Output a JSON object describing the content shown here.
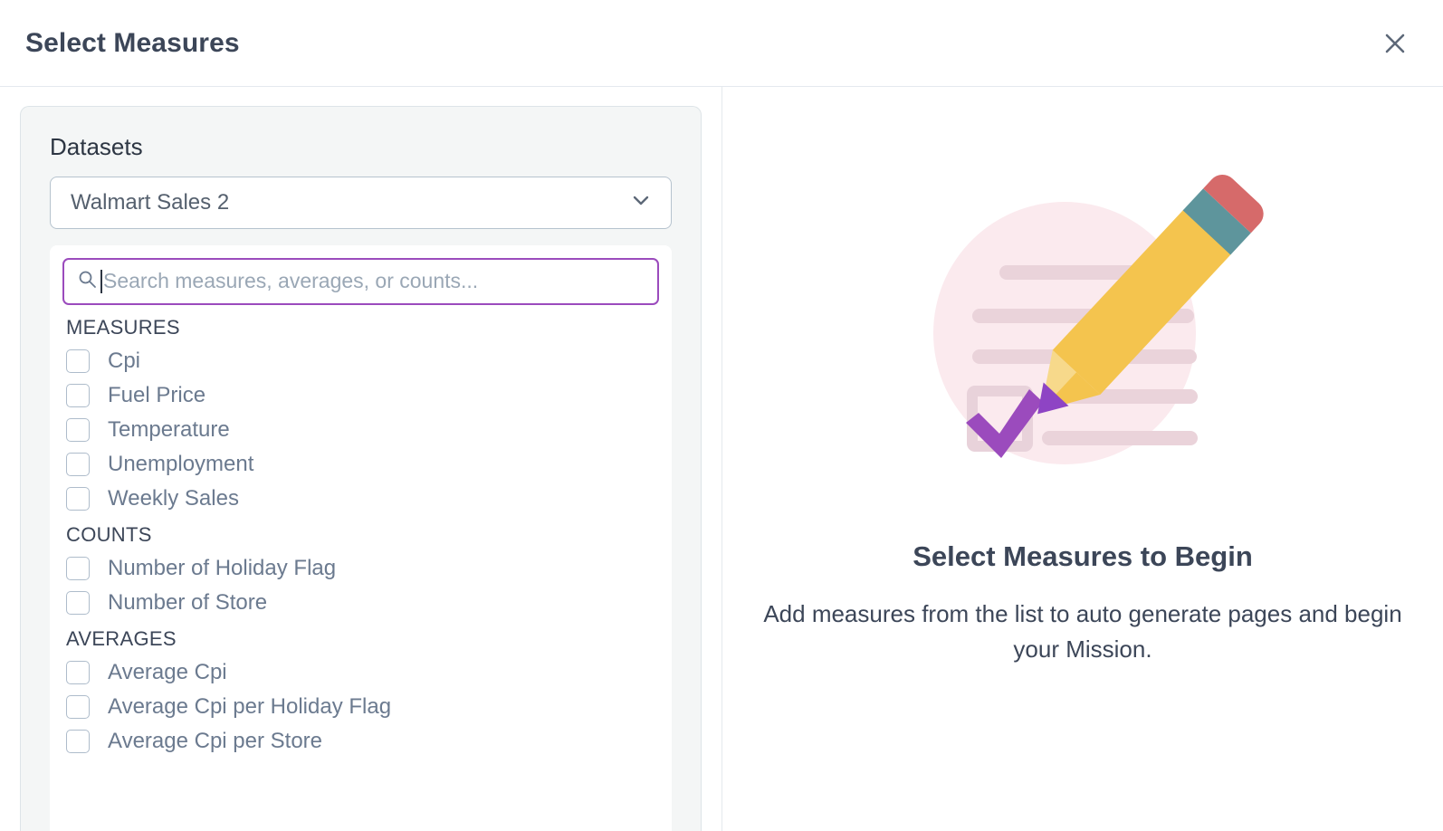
{
  "header": {
    "title": "Select Measures",
    "close_icon": "close-icon"
  },
  "left_panel": {
    "datasets_label": "Datasets",
    "dataset_select": {
      "value": "Walmart Sales 2",
      "chevron_icon": "chevron-down-icon"
    },
    "search": {
      "placeholder": "Search measures, averages, or counts...",
      "value": "",
      "icon": "search-icon"
    },
    "groups": [
      {
        "title": "MEASURES",
        "items": [
          {
            "label": "Cpi",
            "checked": false
          },
          {
            "label": "Fuel Price",
            "checked": false
          },
          {
            "label": "Temperature",
            "checked": false
          },
          {
            "label": "Unemployment",
            "checked": false
          },
          {
            "label": "Weekly Sales",
            "checked": false
          }
        ]
      },
      {
        "title": "COUNTS",
        "items": [
          {
            "label": "Number of Holiday Flag",
            "checked": false
          },
          {
            "label": "Number of Store",
            "checked": false
          }
        ]
      },
      {
        "title": "AVERAGES",
        "items": [
          {
            "label": "Average Cpi",
            "checked": false
          },
          {
            "label": "Average Cpi per Holiday Flag",
            "checked": false
          },
          {
            "label": "Average Cpi per Store",
            "checked": false
          }
        ]
      }
    ]
  },
  "right_panel": {
    "illustration_name": "pencil-checklist-illustration",
    "title": "Select Measures to Begin",
    "description": "Add measures from the list to auto generate pages and begin your Mission."
  },
  "colors": {
    "accent_purple": "#9b4bbd",
    "graphite_purple": "#8e44c4",
    "pencil_yellow": "#f4c44e",
    "pencil_wood": "#f7d98b",
    "eraser_red": "#d66a6a",
    "ferrule_teal": "#5e959c",
    "circle_pink": "#fbeaee",
    "line_pink": "#ead3da",
    "text_dark": "#3c4658",
    "text_muted": "#6b7a8f",
    "card_bg": "#f4f6f6",
    "border": "#dde4e8"
  }
}
